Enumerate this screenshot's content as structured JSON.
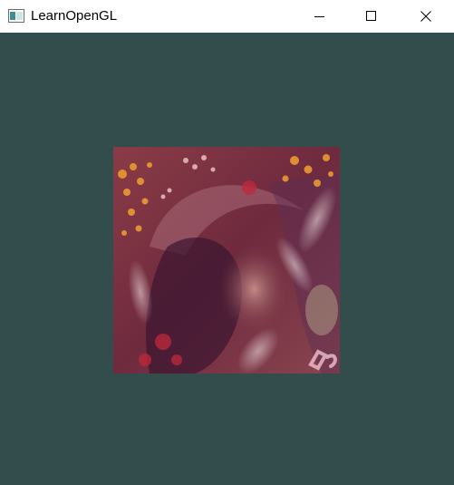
{
  "window": {
    "title": "LearnOpenGL",
    "app_icon": "window-app-icon",
    "controls": {
      "minimize_icon": "minimize-icon",
      "maximize_icon": "maximize-icon",
      "close_icon": "close-icon"
    }
  },
  "viewport": {
    "clear_color": "#334d4d",
    "texture": {
      "description_icon": "blended-texture-quad",
      "base_tint": "#7a2f3c",
      "accent_color": "#f0a030"
    }
  }
}
